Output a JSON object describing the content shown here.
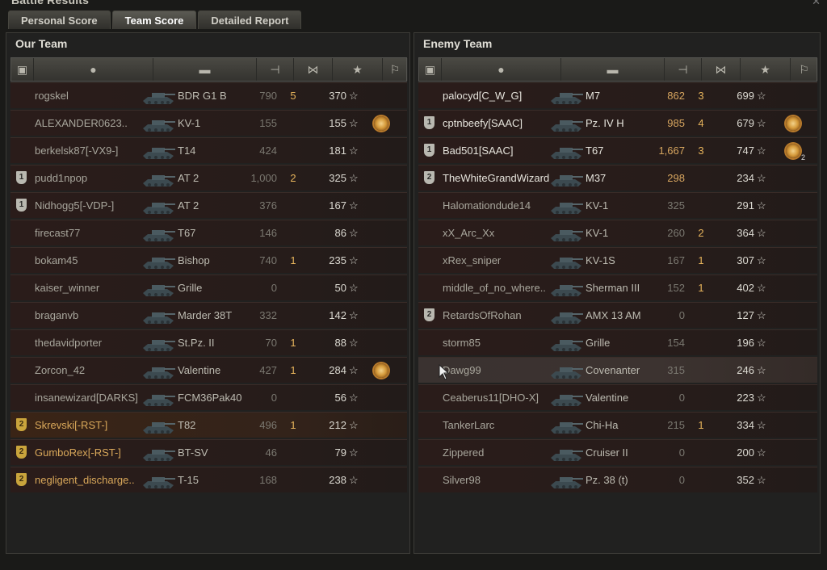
{
  "window": {
    "title": "Battle Results"
  },
  "tabs": [
    {
      "label": "Personal Score",
      "active": false
    },
    {
      "label": "Team Score",
      "active": true
    },
    {
      "label": "Detailed Report",
      "active": false
    }
  ],
  "our_team": {
    "title": "Our Team",
    "rows": [
      {
        "name": "rogskel",
        "tank": "BDR G1 B",
        "damage": "790",
        "kills": "5",
        "xp": "370",
        "platoon": "",
        "medal": false
      },
      {
        "name": "ALEXANDER0623..",
        "tank": "KV-1",
        "damage": "155",
        "kills": "",
        "xp": "155",
        "platoon": "",
        "medal": true
      },
      {
        "name": "berkelsk87[-VX9-]",
        "tank": "T14",
        "damage": "424",
        "kills": "",
        "xp": "181",
        "platoon": "",
        "medal": false
      },
      {
        "name": "pudd1npop",
        "tank": "AT 2",
        "damage": "1,000",
        "kills": "2",
        "xp": "325",
        "platoon": "1",
        "medal": false
      },
      {
        "name": "Nidhogg5[-VDP-]",
        "tank": "AT 2",
        "damage": "376",
        "kills": "",
        "xp": "167",
        "platoon": "1",
        "medal": false
      },
      {
        "name": "firecast77",
        "tank": "T67",
        "damage": "146",
        "kills": "",
        "xp": "86",
        "platoon": "",
        "medal": false
      },
      {
        "name": "bokam45",
        "tank": "Bishop",
        "damage": "740",
        "kills": "1",
        "xp": "235",
        "platoon": "",
        "medal": false
      },
      {
        "name": "kaiser_winner",
        "tank": "Grille",
        "damage": "0",
        "kills": "",
        "xp": "50",
        "platoon": "",
        "medal": false
      },
      {
        "name": "braganvb",
        "tank": "Marder 38T",
        "damage": "332",
        "kills": "",
        "xp": "142",
        "platoon": "",
        "medal": false
      },
      {
        "name": "thedavidporter",
        "tank": "St.Pz. II",
        "damage": "70",
        "kills": "1",
        "xp": "88",
        "platoon": "",
        "medal": false
      },
      {
        "name": "Zorcon_42",
        "tank": "Valentine",
        "damage": "427",
        "kills": "1",
        "xp": "284",
        "platoon": "",
        "medal": true
      },
      {
        "name": "insanewizard[DARKS]",
        "tank": "FCM36Pak40",
        "damage": "0",
        "kills": "",
        "xp": "56",
        "platoon": "",
        "medal": false
      },
      {
        "name": "Skrevski[-RST-]",
        "tank": "T82",
        "damage": "496",
        "kills": "1",
        "xp": "212",
        "platoon": "2",
        "medal": false,
        "self": true
      },
      {
        "name": "GumboRex[-RST-]",
        "tank": "BT-SV",
        "damage": "46",
        "kills": "",
        "xp": "79",
        "platoon": "2",
        "medal": false
      },
      {
        "name": "negligent_discharge..",
        "tank": "T-15",
        "damage": "168",
        "kills": "",
        "xp": "238",
        "platoon": "2",
        "medal": false
      }
    ]
  },
  "enemy_team": {
    "title": "Enemy Team",
    "rows": [
      {
        "name": "palocyd[C_W_G]",
        "tank": "M7",
        "damage": "862",
        "kills": "3",
        "xp": "699",
        "platoon": "",
        "medal": false,
        "alive": true
      },
      {
        "name": "cptnbeefy[SAAC]",
        "tank": "Pz. IV H",
        "damage": "985",
        "kills": "4",
        "xp": "679",
        "platoon": "1",
        "medal": true,
        "alive": true
      },
      {
        "name": "Bad501[SAAC]",
        "tank": "T67",
        "damage": "1,667",
        "kills": "3",
        "xp": "747",
        "platoon": "1",
        "medal": true,
        "medal_count": "2",
        "alive": true
      },
      {
        "name": "TheWhiteGrandWizard",
        "tank": "M37",
        "damage": "298",
        "kills": "",
        "xp": "234",
        "platoon": "2",
        "medal": false,
        "alive": true
      },
      {
        "name": "Halomationdude14",
        "tank": "KV-1",
        "damage": "325",
        "kills": "",
        "xp": "291",
        "platoon": "",
        "medal": false
      },
      {
        "name": "xX_Arc_Xx",
        "tank": "KV-1",
        "damage": "260",
        "kills": "2",
        "xp": "364",
        "platoon": "",
        "medal": false
      },
      {
        "name": "xRex_sniper",
        "tank": "KV-1S",
        "damage": "167",
        "kills": "1",
        "xp": "307",
        "platoon": "",
        "medal": false
      },
      {
        "name": "middle_of_no_where..",
        "tank": "Sherman III",
        "damage": "152",
        "kills": "1",
        "xp": "402",
        "platoon": "",
        "medal": false
      },
      {
        "name": "RetardsOfRohan",
        "tank": "AMX 13 AM",
        "damage": "0",
        "kills": "",
        "xp": "127",
        "platoon": "2",
        "medal": false
      },
      {
        "name": "storm85",
        "tank": "Grille",
        "damage": "154",
        "kills": "",
        "xp": "196",
        "platoon": "",
        "medal": false
      },
      {
        "name": "Dawg99",
        "tank": "Covenanter",
        "damage": "315",
        "kills": "",
        "xp": "246",
        "platoon": "",
        "medal": false,
        "hover": true
      },
      {
        "name": "Ceaberus11[DHO-X]",
        "tank": "Valentine",
        "damage": "0",
        "kills": "",
        "xp": "223",
        "platoon": "",
        "medal": false
      },
      {
        "name": "TankerLarc",
        "tank": "Chi-Ha",
        "damage": "215",
        "kills": "1",
        "xp": "334",
        "platoon": "",
        "medal": false
      },
      {
        "name": "Zippered",
        "tank": "Cruiser II",
        "damage": "0",
        "kills": "",
        "xp": "200",
        "platoon": "",
        "medal": false
      },
      {
        "name": "Silver98",
        "tank": "Pz. 38 (t)",
        "damage": "0",
        "kills": "",
        "xp": "352",
        "platoon": "",
        "medal": false
      }
    ]
  },
  "header_icons": [
    "platoon-icon",
    "player-icon",
    "tank-icon",
    "damage-icon",
    "kills-icon",
    "xp-star-icon",
    "medal-icon"
  ],
  "colors": {
    "accent_gold": "#d9a85a",
    "kill_orange": "#e7b45c"
  }
}
